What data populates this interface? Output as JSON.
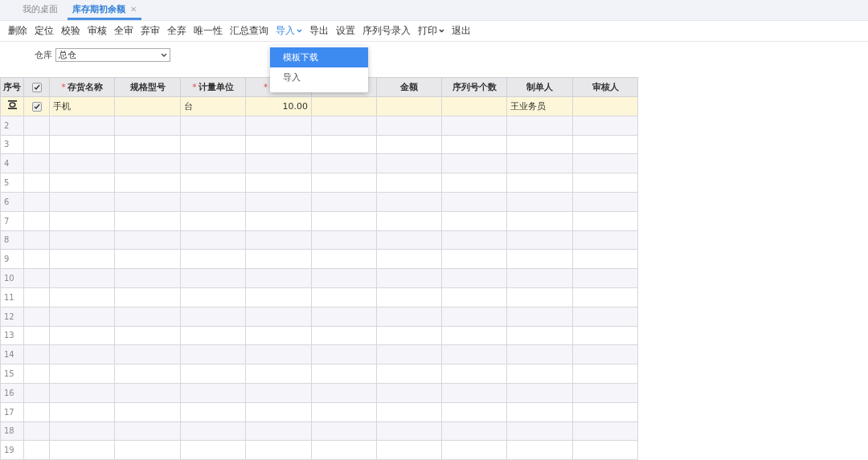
{
  "tabs": [
    {
      "label": "我的桌面",
      "selected": false,
      "closable": false
    },
    {
      "label": "库存期初余额",
      "selected": true,
      "closable": true,
      "close": "✕"
    }
  ],
  "toolbar": [
    {
      "label": "删除",
      "menu": false,
      "open": false
    },
    {
      "label": "定位",
      "menu": false,
      "open": false
    },
    {
      "label": "校验",
      "menu": false,
      "open": false
    },
    {
      "label": "审核",
      "menu": false,
      "open": false
    },
    {
      "label": "全审",
      "menu": false,
      "open": false
    },
    {
      "label": "弃审",
      "menu": false,
      "open": false
    },
    {
      "label": "全弃",
      "menu": false,
      "open": false
    },
    {
      "label": "唯一性",
      "menu": false,
      "open": false
    },
    {
      "label": "汇总查询",
      "menu": false,
      "open": false
    },
    {
      "label": "导入",
      "menu": true,
      "open": true
    },
    {
      "label": "导出",
      "menu": false,
      "open": false
    },
    {
      "label": "设置",
      "menu": false,
      "open": false
    },
    {
      "label": "序列号录入",
      "menu": false,
      "open": false
    },
    {
      "label": "打印",
      "menu": true,
      "open": false
    },
    {
      "label": "退出",
      "menu": false,
      "open": false
    }
  ],
  "dropdown": {
    "items": [
      {
        "label": "模板下载",
        "selected": true
      },
      {
        "label": "导入",
        "selected": false
      }
    ]
  },
  "filter": {
    "label": "仓库",
    "value": "总仓"
  },
  "table": {
    "columns": [
      {
        "kind": "text",
        "label": "序号"
      },
      {
        "kind": "checkbox",
        "checked": true
      },
      {
        "kind": "text",
        "marker": "*",
        "label": "存货名称"
      },
      {
        "kind": "text",
        "label": "规格型号"
      },
      {
        "kind": "text",
        "marker": "*",
        "label": "计量单位"
      },
      {
        "kind": "text",
        "marker": "*"
      },
      {
        "kind": "text"
      },
      {
        "kind": "text",
        "label": "金额"
      },
      {
        "kind": "text",
        "label": "序列号个数"
      },
      {
        "kind": "text",
        "label": "制单人"
      },
      {
        "kind": "text",
        "label": "审核人"
      }
    ],
    "rows": [
      {
        "kind": "entry",
        "selected": true,
        "checked": true,
        "cells": [
          "手机",
          "",
          "台",
          "10.00",
          "",
          "",
          "",
          "王业务员",
          ""
        ]
      },
      {
        "kind": "blank",
        "selected": false,
        "number": "2"
      },
      {
        "kind": "blank",
        "selected": false,
        "number": "3"
      },
      {
        "kind": "blank",
        "selected": false,
        "number": "4"
      },
      {
        "kind": "blank",
        "selected": false,
        "number": "5"
      },
      {
        "kind": "blank",
        "selected": false,
        "number": "6"
      },
      {
        "kind": "blank",
        "selected": false,
        "number": "7"
      },
      {
        "kind": "blank",
        "selected": false,
        "number": "8"
      },
      {
        "kind": "blank",
        "selected": false,
        "number": "9"
      },
      {
        "kind": "blank",
        "selected": false,
        "number": "10"
      },
      {
        "kind": "blank",
        "selected": false,
        "number": "11"
      },
      {
        "kind": "blank",
        "selected": false,
        "number": "12"
      },
      {
        "kind": "blank",
        "selected": false,
        "number": "13"
      },
      {
        "kind": "blank",
        "selected": false,
        "number": "14"
      },
      {
        "kind": "blank",
        "selected": false,
        "number": "15"
      },
      {
        "kind": "blank",
        "selected": false,
        "number": "16"
      },
      {
        "kind": "blank",
        "selected": false,
        "number": "17"
      },
      {
        "kind": "blank",
        "selected": false,
        "number": "18"
      },
      {
        "kind": "blank",
        "selected": false,
        "number": "19"
      }
    ]
  }
}
